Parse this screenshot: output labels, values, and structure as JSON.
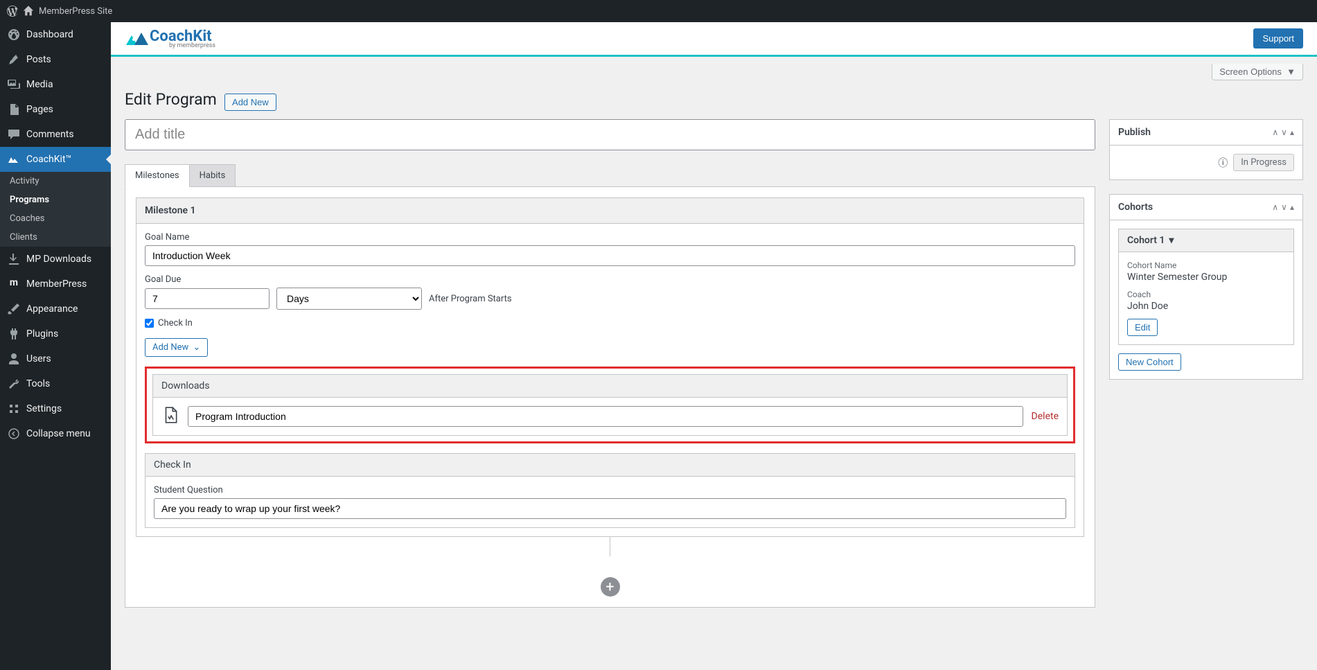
{
  "adminBar": {
    "siteName": "MemberPress Site"
  },
  "sidebar": {
    "items": [
      {
        "label": "Dashboard"
      },
      {
        "label": "Posts"
      },
      {
        "label": "Media"
      },
      {
        "label": "Pages"
      },
      {
        "label": "Comments"
      },
      {
        "label": "CoachKit™"
      },
      {
        "label": "MP Downloads"
      },
      {
        "label": "MemberPress"
      },
      {
        "label": "Appearance"
      },
      {
        "label": "Plugins"
      },
      {
        "label": "Users"
      },
      {
        "label": "Tools"
      },
      {
        "label": "Settings"
      },
      {
        "label": "Collapse menu"
      }
    ],
    "subItems": [
      {
        "label": "Activity"
      },
      {
        "label": "Programs"
      },
      {
        "label": "Coaches"
      },
      {
        "label": "Clients"
      }
    ]
  },
  "header": {
    "supportLabel": "Support",
    "logoMain": "CoachKit",
    "logoSub": "by memberpress"
  },
  "screenOptions": {
    "label": "Screen Options"
  },
  "pageTitle": "Edit Program",
  "addNewPageBtn": "Add New",
  "titlePlaceholder": "Add title",
  "tabs": {
    "milestones": "Milestones",
    "habits": "Habits"
  },
  "milestone": {
    "heading": "Milestone 1",
    "goalNameLabel": "Goal Name",
    "goalNameValue": "Introduction Week",
    "goalDueLabel": "Goal Due",
    "goalDueValue": "7",
    "goalDueUnit": "Days",
    "afterText": "After Program Starts",
    "checkInLabel": "Check In",
    "addNewLabel": "Add New"
  },
  "downloads": {
    "heading": "Downloads",
    "fileName": "Program Introduction",
    "deleteLabel": "Delete"
  },
  "checkIn": {
    "heading": "Check In",
    "questionLabel": "Student Question",
    "questionValue": "Are you ready to wrap up your first week?"
  },
  "publishBox": {
    "title": "Publish",
    "status": "In Progress"
  },
  "cohortsBox": {
    "title": "Cohorts",
    "cohort": {
      "header": "Cohort  1",
      "nameLabel": "Cohort Name",
      "nameValue": "Winter Semester Group",
      "coachLabel": "Coach",
      "coachValue": "John Doe",
      "editLabel": "Edit"
    },
    "newCohortLabel": "New Cohort"
  }
}
